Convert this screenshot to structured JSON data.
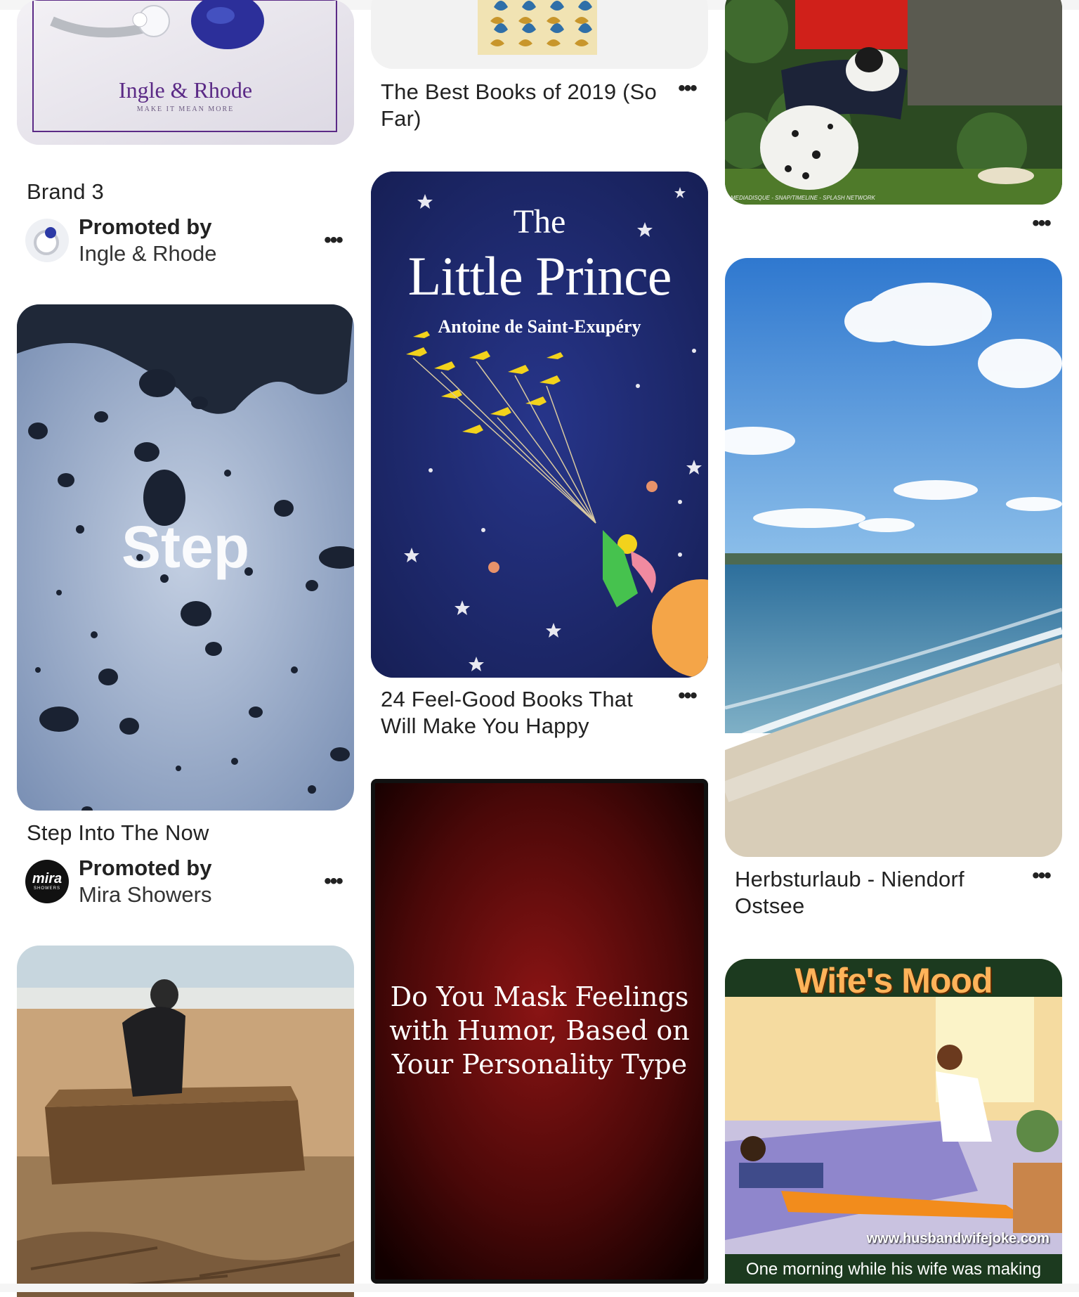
{
  "pins": {
    "ring_ad": {
      "brand": "Ingle & Rhode",
      "tagline": "MAKE IT MEAN MORE",
      "title": "Brand 3",
      "promoted_label": "Promoted by",
      "advertiser": "Ingle & Rhode"
    },
    "books_2019": {
      "title": "The Best Books of 2019 (So Far)"
    },
    "dog_photo": {
      "caption": "MEDIADISQUE - SNAP/TIMELINE - SPLASH NETWORK"
    },
    "step_ad": {
      "overlay": "Step",
      "title": "Step Into The Now",
      "promoted_label": "Promoted by",
      "advertiser": "Mira Showers",
      "avatar_text": "mira",
      "avatar_sub": "SHOWERS"
    },
    "little_prince": {
      "cover_the": "The",
      "cover_title": "Little Prince",
      "cover_author": "Antoine de Saint-Exupéry",
      "title": "24 Feel-Good Books That Will Make You Happy"
    },
    "beach": {
      "title": "Herbsturlaub - Niendorf Ostsee"
    },
    "mask_feelings": {
      "lines": [
        "Do You Mask Feelings",
        "with Humor, Based on",
        "Your Personality Type"
      ]
    },
    "wife_mood": {
      "headline": "Wife's Mood",
      "url": "www.husbandwifejoke.com",
      "caption": "One morning while his wife was making"
    }
  },
  "more_icon": "ellipsis-icon",
  "colors": {
    "ring_bg": "#e9e6ee",
    "ring_purple": "#5b2a86",
    "step_bg": "#8ea3c2",
    "prince_bg": "#1f2a6b",
    "prince_star": "#f2d21c",
    "mask_bg": "#6e1010",
    "sky": "#3f86d6",
    "sea": "#4d8fb8",
    "sand": "#d9cdb9",
    "wife_green": "#1c3a1f",
    "wife_orange": "#f28c1c"
  }
}
